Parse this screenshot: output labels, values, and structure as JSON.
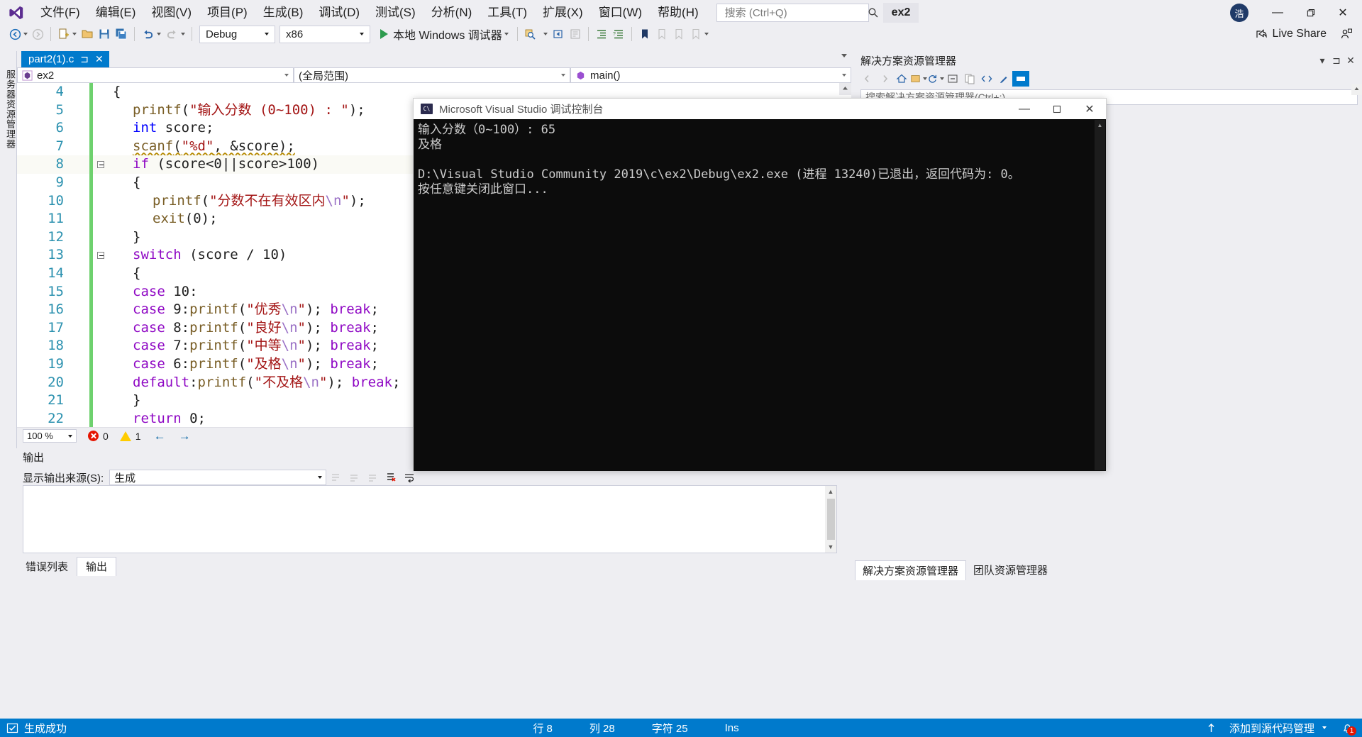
{
  "app": {
    "title": "ex2",
    "logo_icon": "visual-studio-logo",
    "user_initial": "浩"
  },
  "menu": {
    "items": [
      {
        "label": "文件(F)",
        "name": "file"
      },
      {
        "label": "编辑(E)",
        "name": "edit"
      },
      {
        "label": "视图(V)",
        "name": "view"
      },
      {
        "label": "项目(P)",
        "name": "project"
      },
      {
        "label": "生成(B)",
        "name": "build"
      },
      {
        "label": "调试(D)",
        "name": "debug"
      },
      {
        "label": "测试(S)",
        "name": "test"
      },
      {
        "label": "分析(N)",
        "name": "analyze"
      },
      {
        "label": "工具(T)",
        "name": "tools"
      },
      {
        "label": "扩展(X)",
        "name": "extensions"
      },
      {
        "label": "窗口(W)",
        "name": "window"
      },
      {
        "label": "帮助(H)",
        "name": "help"
      }
    ]
  },
  "search": {
    "placeholder": "搜索 (Ctrl+Q)",
    "value": "",
    "icon": "search-icon"
  },
  "window_controls": {
    "minimize": "—",
    "maximize": "❐",
    "close": "✕"
  },
  "toolbar": {
    "config": "Debug",
    "platform": "x86",
    "run_label": "本地 Windows 调试器",
    "live_share": "Live Share",
    "icons": [
      "navigate-back-icon",
      "navigate-forward-icon",
      "new-item-icon",
      "open-file-icon",
      "save-icon",
      "save-all-icon",
      "undo-icon",
      "redo-icon"
    ]
  },
  "left_vertical_tab": {
    "label": "服务器资源管理器"
  },
  "editor": {
    "tab": {
      "filename": "part2(1).c",
      "pin_icon": "pin-icon",
      "close_icon": "close-icon"
    },
    "nav": {
      "project": "ex2",
      "scope": "(全局范围)",
      "member": "main()"
    },
    "zoom": "100 %",
    "error_count": "0",
    "warning_count": "1",
    "lines": [
      {
        "num": "4",
        "indent": 0,
        "fold": "",
        "tokens": [
          {
            "t": "{",
            "c": "pln"
          }
        ]
      },
      {
        "num": "5",
        "indent": 1,
        "fold": "",
        "tokens": [
          {
            "t": "printf",
            "c": "fn"
          },
          {
            "t": "(",
            "c": "pln"
          },
          {
            "t": "\"输入分数 (0~100) : \"",
            "c": "str"
          },
          {
            "t": ");",
            "c": "pln"
          }
        ]
      },
      {
        "num": "6",
        "indent": 1,
        "fold": "",
        "tokens": [
          {
            "t": "int",
            "c": "kw"
          },
          {
            "t": " score;",
            "c": "pln"
          }
        ]
      },
      {
        "num": "7",
        "indent": 1,
        "fold": "",
        "tokens": [
          {
            "t": "scanf",
            "c": "fn squig"
          },
          {
            "t": "(",
            "c": "pln squig"
          },
          {
            "t": "\"%d\"",
            "c": "str squig"
          },
          {
            "t": ", &score);",
            "c": "pln squig"
          }
        ]
      },
      {
        "num": "8",
        "indent": 1,
        "fold": "-",
        "current": true,
        "tokens": [
          {
            "t": "if",
            "c": "kw2"
          },
          {
            "t": " (score<0",
            "c": "pln"
          },
          {
            "t": "||",
            "c": "pln",
            "caret": true
          },
          {
            "t": "score>100)",
            "c": "pln"
          }
        ]
      },
      {
        "num": "9",
        "indent": 1,
        "fold": "",
        "tokens": [
          {
            "t": "{",
            "c": "pln"
          }
        ]
      },
      {
        "num": "10",
        "indent": 2,
        "fold": "",
        "tokens": [
          {
            "t": "printf",
            "c": "fn"
          },
          {
            "t": "(",
            "c": "pln"
          },
          {
            "t": "\"分数不在有效区内",
            "c": "str"
          },
          {
            "t": "\\n",
            "c": "esc"
          },
          {
            "t": "\"",
            "c": "str"
          },
          {
            "t": ");",
            "c": "pln"
          }
        ]
      },
      {
        "num": "11",
        "indent": 2,
        "fold": "",
        "tokens": [
          {
            "t": "exit",
            "c": "fn"
          },
          {
            "t": "(0);",
            "c": "pln"
          }
        ]
      },
      {
        "num": "12",
        "indent": 1,
        "fold": "",
        "tokens": [
          {
            "t": "}",
            "c": "pln"
          }
        ]
      },
      {
        "num": "13",
        "indent": 1,
        "fold": "-",
        "tokens": [
          {
            "t": "switch",
            "c": "kw2"
          },
          {
            "t": " (score / 10)",
            "c": "pln"
          }
        ]
      },
      {
        "num": "14",
        "indent": 1,
        "fold": "",
        "tokens": [
          {
            "t": "{",
            "c": "pln"
          }
        ]
      },
      {
        "num": "15",
        "indent": 1,
        "fold": "",
        "tokens": [
          {
            "t": "case",
            "c": "kw2"
          },
          {
            "t": " 10:",
            "c": "pln"
          }
        ]
      },
      {
        "num": "16",
        "indent": 1,
        "fold": "",
        "tokens": [
          {
            "t": "case",
            "c": "kw2"
          },
          {
            "t": " 9:",
            "c": "pln"
          },
          {
            "t": "printf",
            "c": "fn"
          },
          {
            "t": "(",
            "c": "pln"
          },
          {
            "t": "\"优秀",
            "c": "str"
          },
          {
            "t": "\\n",
            "c": "esc"
          },
          {
            "t": "\"",
            "c": "str"
          },
          {
            "t": "); ",
            "c": "pln"
          },
          {
            "t": "break",
            "c": "kw2"
          },
          {
            "t": ";",
            "c": "pln"
          }
        ]
      },
      {
        "num": "17",
        "indent": 1,
        "fold": "",
        "tokens": [
          {
            "t": "case",
            "c": "kw2"
          },
          {
            "t": " 8:",
            "c": "pln"
          },
          {
            "t": "printf",
            "c": "fn"
          },
          {
            "t": "(",
            "c": "pln"
          },
          {
            "t": "\"良好",
            "c": "str"
          },
          {
            "t": "\\n",
            "c": "esc"
          },
          {
            "t": "\"",
            "c": "str"
          },
          {
            "t": "); ",
            "c": "pln"
          },
          {
            "t": "break",
            "c": "kw2"
          },
          {
            "t": ";",
            "c": "pln"
          }
        ]
      },
      {
        "num": "18",
        "indent": 1,
        "fold": "",
        "tokens": [
          {
            "t": "case",
            "c": "kw2"
          },
          {
            "t": " 7:",
            "c": "pln"
          },
          {
            "t": "printf",
            "c": "fn"
          },
          {
            "t": "(",
            "c": "pln"
          },
          {
            "t": "\"中等",
            "c": "str"
          },
          {
            "t": "\\n",
            "c": "esc"
          },
          {
            "t": "\"",
            "c": "str"
          },
          {
            "t": "); ",
            "c": "pln"
          },
          {
            "t": "break",
            "c": "kw2"
          },
          {
            "t": ";",
            "c": "pln"
          }
        ]
      },
      {
        "num": "19",
        "indent": 1,
        "fold": "",
        "tokens": [
          {
            "t": "case",
            "c": "kw2"
          },
          {
            "t": " 6:",
            "c": "pln"
          },
          {
            "t": "printf",
            "c": "fn"
          },
          {
            "t": "(",
            "c": "pln"
          },
          {
            "t": "\"及格",
            "c": "str"
          },
          {
            "t": "\\n",
            "c": "esc"
          },
          {
            "t": "\"",
            "c": "str"
          },
          {
            "t": "); ",
            "c": "pln"
          },
          {
            "t": "break",
            "c": "kw2"
          },
          {
            "t": ";",
            "c": "pln"
          }
        ]
      },
      {
        "num": "20",
        "indent": 1,
        "fold": "",
        "tokens": [
          {
            "t": "default",
            "c": "kw2"
          },
          {
            "t": ":",
            "c": "pln"
          },
          {
            "t": "printf",
            "c": "fn"
          },
          {
            "t": "(",
            "c": "pln"
          },
          {
            "t": "\"不及格",
            "c": "str"
          },
          {
            "t": "\\n",
            "c": "esc"
          },
          {
            "t": "\"",
            "c": "str"
          },
          {
            "t": "); ",
            "c": "pln"
          },
          {
            "t": "break",
            "c": "kw2"
          },
          {
            "t": ";",
            "c": "pln"
          }
        ]
      },
      {
        "num": "21",
        "indent": 1,
        "fold": "",
        "tokens": [
          {
            "t": "}",
            "c": "pln"
          }
        ]
      },
      {
        "num": "22",
        "indent": 1,
        "fold": "",
        "tokens": [
          {
            "t": "return",
            "c": "kw2"
          },
          {
            "t": " 0;",
            "c": "pln"
          }
        ]
      }
    ]
  },
  "output_panel": {
    "title": "输出",
    "source_label": "显示输出来源(S):",
    "source_value": "生成",
    "body": ""
  },
  "bottom_tabs": [
    {
      "label": "错误列表",
      "active": false
    },
    {
      "label": "输出",
      "active": true
    }
  ],
  "solution_explorer": {
    "title": "解决方案资源管理器",
    "search_placeholder": "搜索解决方案资源管理器(Ctrl+;)",
    "tabs": [
      {
        "label": "解决方案资源管理器",
        "active": true
      },
      {
        "label": "团队资源管理器",
        "active": false
      }
    ]
  },
  "console_window": {
    "title": "Microsoft Visual Studio 调试控制台",
    "icon": "console-icon",
    "minimize": "—",
    "maximize": "❐",
    "close": "✕",
    "output": "输入分数（0~100）: 65\n及格\n\nD:\\Visual Studio Community 2019\\c\\ex2\\Debug\\ex2.exe (进程 13240)已退出，返回代码为: 0。\n按任意键关闭此窗口..."
  },
  "statusbar": {
    "build_status": "生成成功",
    "row_label": "行 8",
    "col_label": "列 28",
    "char_label": "字符 25",
    "ins_label": "Ins",
    "source_control": "添加到源代码管理",
    "notification_count": "1",
    "accent": "#007acc"
  }
}
